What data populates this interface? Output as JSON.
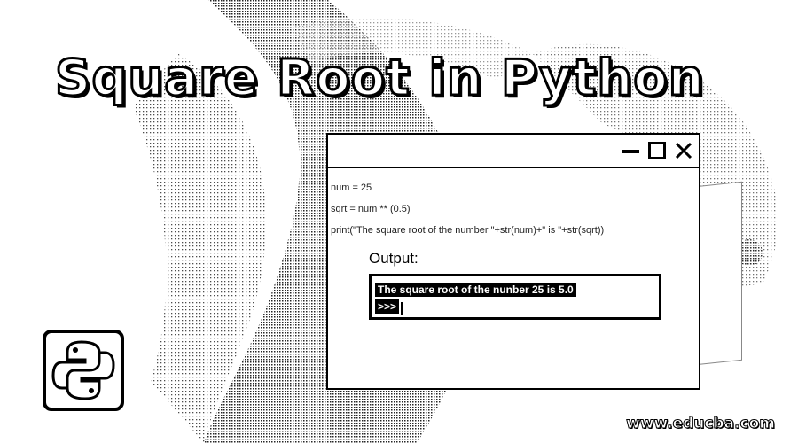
{
  "headline": "Square Root in Python",
  "window": {
    "code_lines": [
      "num = 25",
      "sqrt = num ** (0.5)",
      "print(\"The square root of the number \"+str(num)+\" is \"+str(sqrt))"
    ],
    "output_label": "Output:",
    "output_line": "The square root of the nunber 25 is 5.0",
    "prompt": ">>>"
  },
  "watermark": "www.educba.com",
  "icons": [
    "minimize-icon",
    "maximize-icon",
    "close-icon",
    "python-logo-icon"
  ]
}
